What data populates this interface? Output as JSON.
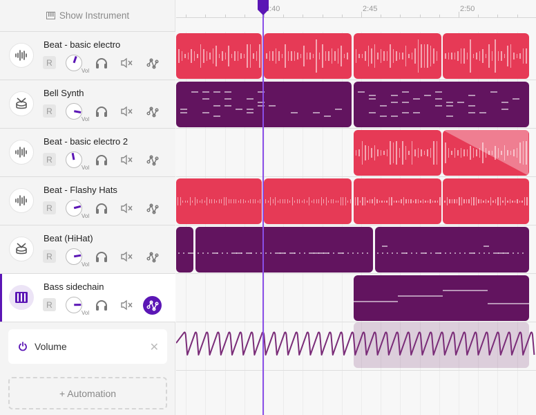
{
  "header": {
    "show_instrument_label": "Show Instrument"
  },
  "tracks": [
    {
      "name": "Beat - basic electro",
      "icon": "waveform-icon",
      "record_label": "R",
      "volume_label": "Vol",
      "volume": 0.57,
      "automation_active": false,
      "selected": false
    },
    {
      "name": "Bell Synth",
      "icon": "drum-icon",
      "record_label": "R",
      "volume_label": "Vol",
      "volume": 0.87,
      "automation_active": false,
      "selected": false
    },
    {
      "name": "Beat - basic electro 2",
      "icon": "waveform-icon",
      "record_label": "R",
      "volume_label": "Vol",
      "volume": 0.46,
      "automation_active": false,
      "selected": false
    },
    {
      "name": "Beat - Flashy Hats",
      "icon": "waveform-icon",
      "record_label": "R",
      "volume_label": "Vol",
      "volume": 0.78,
      "automation_active": false,
      "selected": false
    },
    {
      "name": "Beat (HiHat)",
      "icon": "drum-icon",
      "record_label": "R",
      "volume_label": "Vol",
      "volume": 0.8,
      "automation_active": false,
      "selected": false
    },
    {
      "name": "Bass sidechain",
      "icon": "piano-icon",
      "record_label": "R",
      "volume_label": "Vol",
      "volume": 0.83,
      "automation_active": true,
      "selected": true
    }
  ],
  "automation": {
    "lane_label": "Volume",
    "add_label": "+ Automation"
  },
  "ruler": {
    "labels": [
      {
        "text": "2:40",
        "t": 160
      },
      {
        "text": "2:45",
        "t": 165
      },
      {
        "text": "2:50",
        "t": 170
      }
    ]
  },
  "playhead_time": 159.95,
  "colors": {
    "audio_clip": "#e63a56",
    "midi_clip": "#62145f",
    "accent": "#5b16b5",
    "playhead": "#8a4ee8"
  },
  "clips": [
    {
      "track": 0,
      "type": "audio",
      "spans": [
        [
          155.5,
          159.9
        ],
        [
          160,
          164.5
        ],
        [
          164.6,
          169.1
        ],
        [
          169.2,
          173.6
        ]
      ]
    },
    {
      "track": 1,
      "type": "midi",
      "spans": [
        [
          155.5,
          164.5
        ],
        [
          164.6,
          173.6
        ]
      ]
    },
    {
      "track": 2,
      "type": "audio",
      "spans": [
        [
          164.6,
          169.1
        ],
        [
          169.2,
          173.6
        ]
      ],
      "fade_out_last": true
    },
    {
      "track": 3,
      "type": "audio-hats",
      "spans": [
        [
          155.5,
          159.9
        ],
        [
          160,
          164.5
        ],
        [
          164.6,
          169.1
        ],
        [
          169.2,
          173.6
        ]
      ]
    },
    {
      "track": 4,
      "type": "midi-hats",
      "spans": [
        [
          155.5,
          156.4
        ],
        [
          156.5,
          165.6
        ],
        [
          165.7,
          173.6
        ]
      ]
    },
    {
      "track": 5,
      "type": "bass",
      "spans": [
        [
          164.6,
          173.6
        ]
      ]
    }
  ],
  "automation_clip": {
    "span": [
      164.6,
      173.6
    ]
  }
}
